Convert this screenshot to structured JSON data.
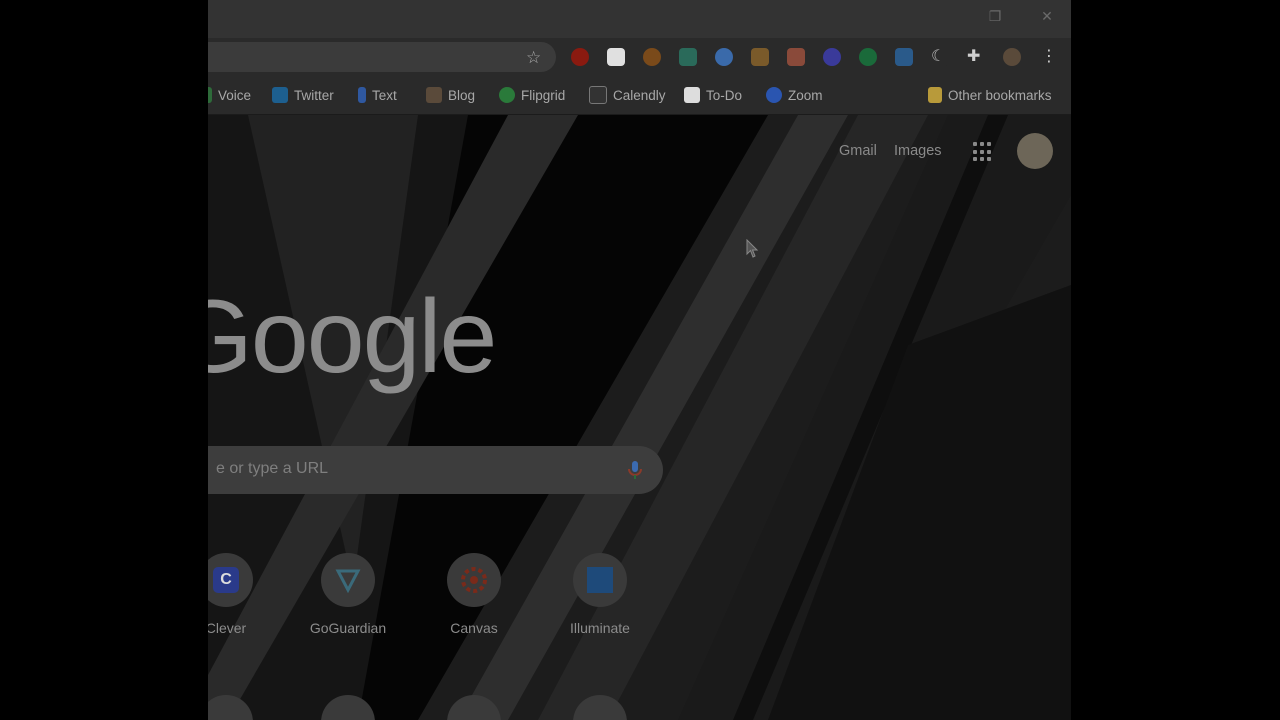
{
  "bookmarks": [
    {
      "label": "Voice",
      "color": "#2e6b3a"
    },
    {
      "label": "Twitter",
      "color": "#1d5f8f"
    },
    {
      "label": "Text",
      "color": "#2f58a0"
    },
    {
      "label": "Blog",
      "color": "#5a4a3a"
    },
    {
      "label": "Flipgrid",
      "color": "#2a7a3a"
    },
    {
      "label": "Calendly",
      "color": "#555555"
    },
    {
      "label": "To-Do",
      "color": "#dddddd"
    },
    {
      "label": "Zoom",
      "color": "#2a55b0"
    }
  ],
  "other_bookmarks": "Other bookmarks",
  "top_links": {
    "gmail": "Gmail",
    "images": "Images"
  },
  "logo": "Google",
  "search": {
    "placeholder": "e or type a URL"
  },
  "shortcuts": [
    {
      "label": "Clever",
      "glyph": "C"
    },
    {
      "label": "GoGuardian",
      "glyph": ""
    },
    {
      "label": "Canvas",
      "glyph": ""
    },
    {
      "label": "Illuminate",
      "glyph": ""
    }
  ],
  "extensions": [
    "ublock-icon",
    "qr-code-icon",
    "b-icon",
    "screen-capture-icon",
    "heart-icon",
    "party-icon",
    "share-icon",
    "gear-icon",
    "chat-icon",
    "calendar-icon",
    "moon-icon",
    "puzzle-icon",
    "profile-icon",
    "more-icon"
  ],
  "colors": {
    "accent": "#8ab4f8",
    "bg": "#000000"
  }
}
